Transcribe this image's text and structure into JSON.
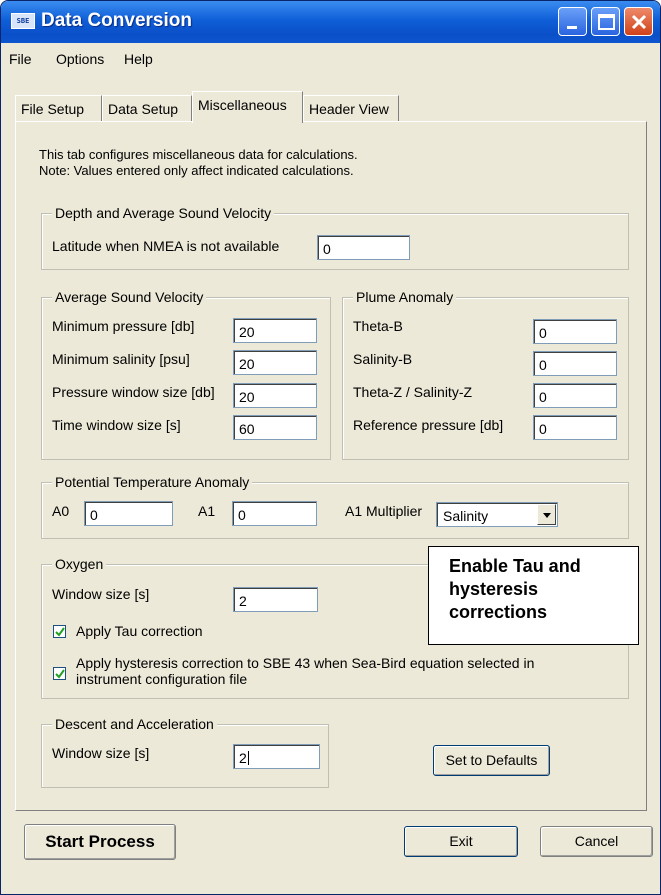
{
  "window": {
    "title": "Data Conversion",
    "icon_text": "SBE",
    "controls": [
      "minimize-icon",
      "maximize-icon",
      "close-icon"
    ]
  },
  "menu": {
    "items": [
      "File",
      "Options",
      "Help"
    ]
  },
  "tabs": [
    "File Setup",
    "Data Setup",
    "Miscellaneous",
    "Header View"
  ],
  "active_tab": "Miscellaneous",
  "intro": {
    "line1": "This tab configures miscellaneous data for calculations.",
    "line2": "Note: Values entered only affect indicated calculations."
  },
  "depth_group": {
    "title": "Depth and Average Sound Velocity",
    "latitude_label": "Latitude when NMEA is not available",
    "latitude_value": "0"
  },
  "avg_sound_velocity": {
    "title": "Average Sound Velocity",
    "rows": [
      {
        "label": "Minimum pressure [db]",
        "value": "20"
      },
      {
        "label": "Minimum salinity [psu]",
        "value": "20"
      },
      {
        "label": "Pressure window size [db]",
        "value": "20"
      },
      {
        "label": "Time window size [s]",
        "value": "60"
      }
    ]
  },
  "plume_anomaly": {
    "title": "Plume Anomaly",
    "rows": [
      {
        "label": "Theta-B",
        "value": "0"
      },
      {
        "label": "Salinity-B",
        "value": "0"
      },
      {
        "label": "Theta-Z / Salinity-Z",
        "value": "0"
      },
      {
        "label": "Reference pressure [db]",
        "value": "0"
      }
    ]
  },
  "potential_temp": {
    "title": "Potential Temperature Anomaly",
    "a0_label": "A0",
    "a0_value": "0",
    "a1_label": "A1",
    "a1_value": "0",
    "multiplier_label": "A1 Multiplier",
    "multiplier_value": "Salinity"
  },
  "oxygen": {
    "title": "Oxygen",
    "window_label": "Window size [s]",
    "window_value": "2",
    "tau_label": "Apply Tau correction",
    "tau_checked": true,
    "hysteresis_label_1": "Apply hysteresis correction to SBE 43 when Sea-Bird equation selected in",
    "hysteresis_label_2": "instrument configuration file",
    "hysteresis_checked": true
  },
  "descent": {
    "title": "Descent and Acceleration",
    "window_label": "Window size [s]",
    "window_value": "2"
  },
  "buttons": {
    "defaults": "Set to Defaults",
    "start": "Start Process",
    "exit": "Exit",
    "cancel": "Cancel"
  },
  "callout": {
    "line1": "Enable Tau and",
    "line2": "hysteresis",
    "line3": "corrections"
  }
}
